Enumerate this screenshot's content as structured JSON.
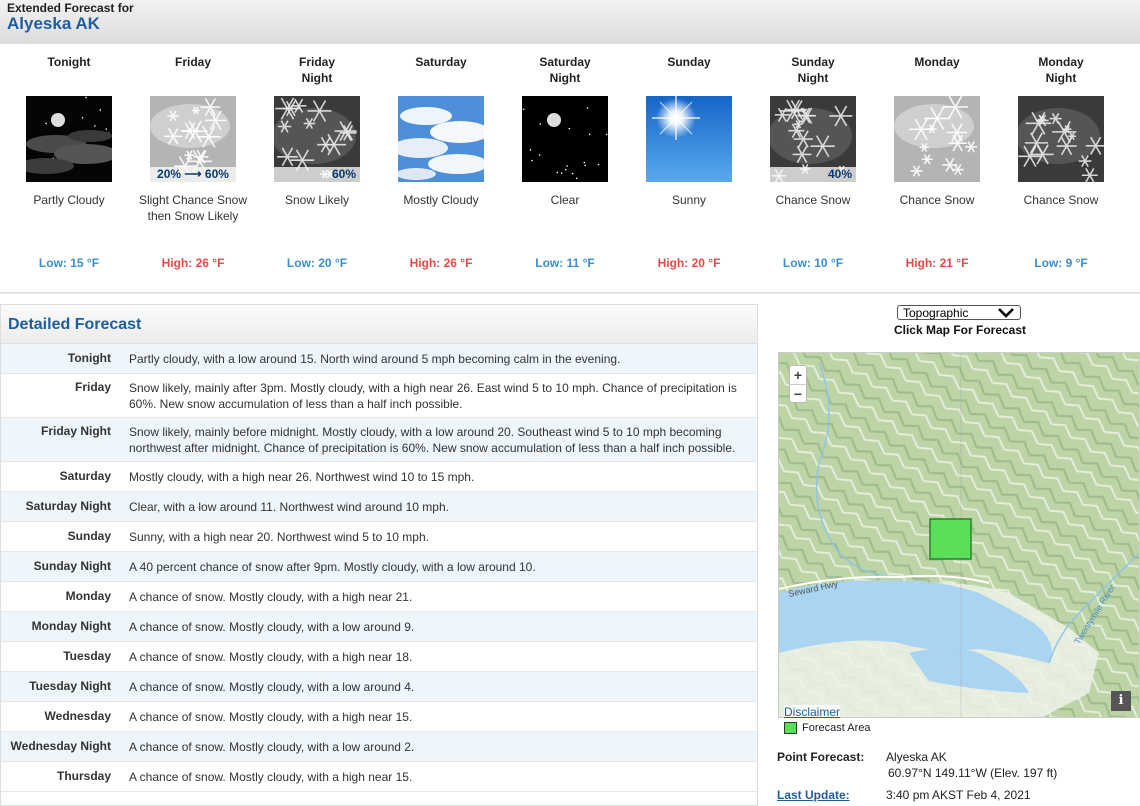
{
  "header": {
    "small": "Extended Forecast for",
    "location": "Alyeska AK"
  },
  "periods": [
    {
      "name": "Tonight",
      "icon": "partly-cloudy-night-icon",
      "pop": "",
      "desc": "Partly Cloudy",
      "temp": "Low: 15 °F",
      "kind": "low"
    },
    {
      "name": "Friday",
      "icon": "snow-day-icon",
      "pop": "20% ⟶ 60%",
      "desc": "Slight Chance Snow then Snow Likely",
      "temp": "High: 26 °F",
      "kind": "high"
    },
    {
      "name": "Friday Night",
      "icon": "snow-night-icon",
      "pop": "60%",
      "desc": "Snow Likely",
      "temp": "Low: 20 °F",
      "kind": "low"
    },
    {
      "name": "Saturday",
      "icon": "mostly-cloudy-icon",
      "pop": "",
      "desc": "Mostly Cloudy",
      "temp": "High: 26 °F",
      "kind": "high"
    },
    {
      "name": "Saturday Night",
      "icon": "clear-night-icon",
      "pop": "",
      "desc": "Clear",
      "temp": "Low: 11 °F",
      "kind": "low"
    },
    {
      "name": "Sunday",
      "icon": "sunny-icon",
      "pop": "",
      "desc": "Sunny",
      "temp": "High: 20 °F",
      "kind": "high"
    },
    {
      "name": "Sunday Night",
      "icon": "snow-night-icon",
      "pop": "40%",
      "desc": "Chance Snow",
      "temp": "Low: 10 °F",
      "kind": "low"
    },
    {
      "name": "Monday",
      "icon": "snow-day-icon",
      "pop": "",
      "desc": "Chance Snow",
      "temp": "High: 21 °F",
      "kind": "high"
    },
    {
      "name": "Monday Night",
      "icon": "snow-night-icon",
      "pop": "",
      "desc": "Chance Snow",
      "temp": "Low: 9 °F",
      "kind": "low"
    }
  ],
  "detail": {
    "title": "Detailed Forecast",
    "rows": [
      {
        "label": "Tonight",
        "text": "Partly cloudy, with a low around 15. North wind around 5 mph becoming calm in the evening."
      },
      {
        "label": "Friday",
        "text": "Snow likely, mainly after 3pm. Mostly cloudy, with a high near 26. East wind 5 to 10 mph. Chance of precipitation is 60%. New snow accumulation of less than a half inch possible."
      },
      {
        "label": "Friday Night",
        "text": "Snow likely, mainly before midnight. Mostly cloudy, with a low around 20. Southeast wind 5 to 10 mph becoming northwest after midnight. Chance of precipitation is 60%. New snow accumulation of less than a half inch possible."
      },
      {
        "label": "Saturday",
        "text": "Mostly cloudy, with a high near 26. Northwest wind 10 to 15 mph."
      },
      {
        "label": "Saturday Night",
        "text": "Clear, with a low around 11. Northwest wind around 10 mph."
      },
      {
        "label": "Sunday",
        "text": "Sunny, with a high near 20. Northwest wind 5 to 10 mph."
      },
      {
        "label": "Sunday Night",
        "text": "A 40 percent chance of snow after 9pm. Mostly cloudy, with a low around 10."
      },
      {
        "label": "Monday",
        "text": "A chance of snow. Mostly cloudy, with a high near 21."
      },
      {
        "label": "Monday Night",
        "text": "A chance of snow. Mostly cloudy, with a low around 9."
      },
      {
        "label": "Tuesday",
        "text": "A chance of snow. Mostly cloudy, with a high near 18."
      },
      {
        "label": "Tuesday Night",
        "text": "A chance of snow. Mostly cloudy, with a low around 4."
      },
      {
        "label": "Wednesday",
        "text": "A chance of snow. Mostly cloudy, with a high near 15."
      },
      {
        "label": "Wednesday Night",
        "text": "A chance of snow. Mostly cloudy, with a low around 2."
      },
      {
        "label": "Thursday",
        "text": "A chance of snow. Mostly cloudy, with a high near 15."
      }
    ]
  },
  "map": {
    "select_value": "Topographic",
    "hint": "Click Map For Forecast",
    "zoom_in": "+",
    "zoom_out": "−",
    "road_label": "Seward Hwy",
    "river_label": "Twentymile River",
    "info": "i",
    "disclaimer": "Disclaimer",
    "legend": "Forecast Area"
  },
  "point": {
    "label": "Point Forecast:",
    "location": "Alyeska AK",
    "coords": "60.97°N 149.11°W (Elev. 197 ft)",
    "update_label": "Last Update:",
    "update_value": "3:40 pm AKST Feb 4, 2021"
  },
  "colors": {
    "title_blue": "#1f5e9e",
    "low": "#3a8fd2",
    "high": "#e34a4a",
    "forecast_area": "#55e055"
  }
}
